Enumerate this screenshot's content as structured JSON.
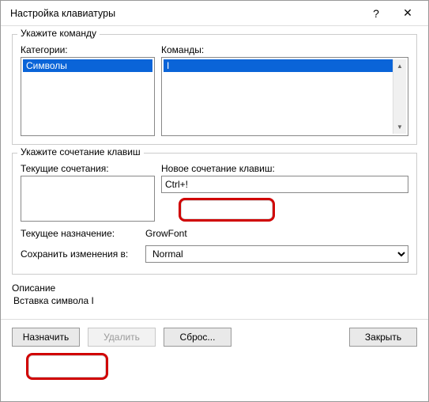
{
  "window": {
    "title": "Настройка клавиатуры",
    "help_glyph": "?",
    "close_glyph": "✕"
  },
  "section_command": {
    "legend": "Укажите команду",
    "categories_label": "Категории:",
    "commands_label": "Команды:",
    "categories": [
      "Символы"
    ],
    "commands": [
      "I"
    ]
  },
  "section_shortcut": {
    "legend": "Укажите сочетание клавиш",
    "current_label": "Текущие сочетания:",
    "new_label": "Новое сочетание клавиш:",
    "new_value": "Ctrl+!",
    "assigned_label": "Текущее назначение:",
    "assigned_value": "GrowFont",
    "save_in_label": "Сохранить изменения в:",
    "save_in_value": "Normal"
  },
  "description": {
    "title": "Описание",
    "text": "Вставка символа I"
  },
  "buttons": {
    "assign": "Назначить",
    "remove": "Удалить",
    "reset": "Сброс...",
    "close": "Закрыть"
  },
  "chart_data": null
}
